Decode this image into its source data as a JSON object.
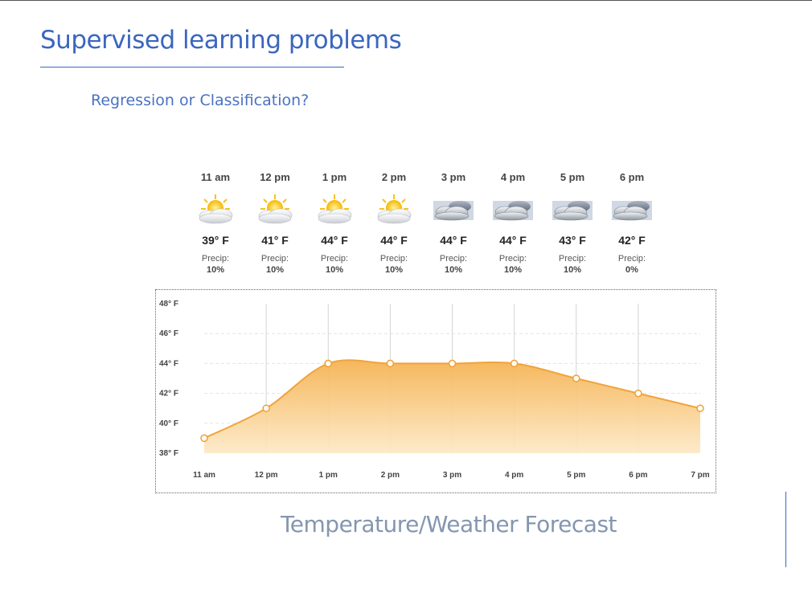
{
  "title": "Supervised learning problems",
  "subtitle": "Regression or Classification?",
  "caption": "Temperature/Weather Forecast",
  "forecast": [
    {
      "time": "11 am",
      "icon": "partly-sunny-icon",
      "temp": "39° F",
      "precip_label": "Precip:",
      "precip": "10%"
    },
    {
      "time": "12 pm",
      "icon": "partly-sunny-icon",
      "temp": "41° F",
      "precip_label": "Precip:",
      "precip": "10%"
    },
    {
      "time": "1 pm",
      "icon": "partly-sunny-icon",
      "temp": "44° F",
      "precip_label": "Precip:",
      "precip": "10%"
    },
    {
      "time": "2 pm",
      "icon": "partly-sunny-icon",
      "temp": "44° F",
      "precip_label": "Precip:",
      "precip": "10%"
    },
    {
      "time": "3 pm",
      "icon": "cloudy-icon",
      "temp": "44° F",
      "precip_label": "Precip:",
      "precip": "10%"
    },
    {
      "time": "4 pm",
      "icon": "cloudy-icon",
      "temp": "44° F",
      "precip_label": "Precip:",
      "precip": "10%"
    },
    {
      "time": "5 pm",
      "icon": "cloudy-icon",
      "temp": "43° F",
      "precip_label": "Precip:",
      "precip": "10%"
    },
    {
      "time": "6 pm",
      "icon": "cloudy-icon",
      "temp": "42° F",
      "precip_label": "Precip:",
      "precip": "0%"
    }
  ],
  "colors": {
    "accent": "#3b66bf",
    "area": "#f5b353",
    "point_stroke": "#f0a030"
  },
  "chart_data": {
    "type": "area",
    "x": [
      "11 am",
      "12 pm",
      "1 pm",
      "2 pm",
      "3 pm",
      "4 pm",
      "5 pm",
      "6 pm",
      "7 pm"
    ],
    "values": [
      39,
      41,
      44,
      44,
      44,
      44,
      43,
      42,
      41
    ],
    "y_ticks": [
      "48° F",
      "46° F",
      "44° F",
      "42° F",
      "40° F",
      "38° F"
    ],
    "ylim": [
      38,
      48
    ],
    "grid": true
  }
}
